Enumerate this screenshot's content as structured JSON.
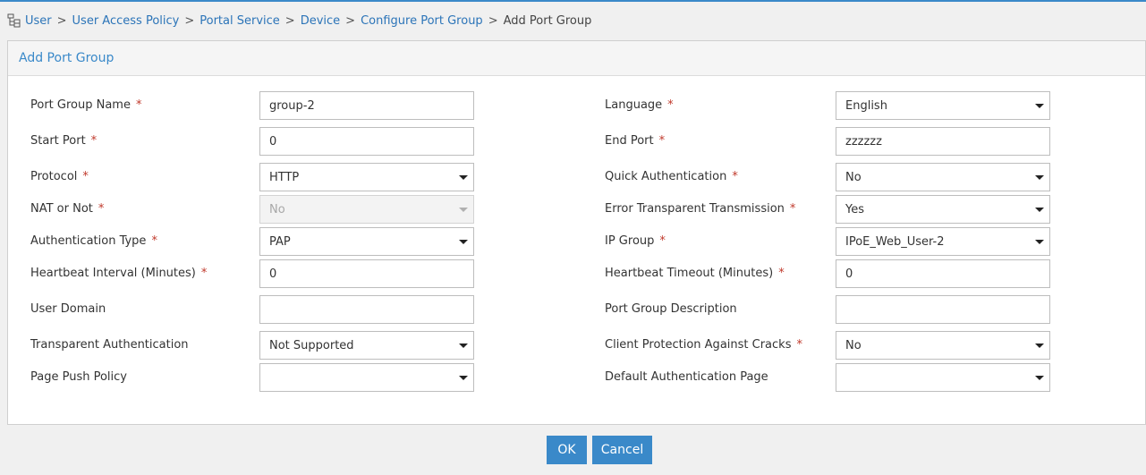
{
  "breadcrumb": {
    "icon": "tree-icon",
    "items": [
      "User",
      "User Access Policy",
      "Portal Service",
      "Device",
      "Configure Port Group"
    ],
    "current": "Add Port Group",
    "separator": ">"
  },
  "panel": {
    "title": "Add Port Group"
  },
  "required_mark": "*",
  "form": {
    "left": [
      {
        "label": "Port Group Name",
        "required": true,
        "type": "text",
        "value": "group-2"
      },
      {
        "label": "Start Port",
        "required": true,
        "type": "text",
        "value": "0"
      },
      {
        "label": "Protocol",
        "required": true,
        "type": "select",
        "value": "HTTP"
      },
      {
        "label": "NAT or Not",
        "required": true,
        "type": "select",
        "value": "No",
        "disabled": true
      },
      {
        "label": "Authentication Type",
        "required": true,
        "type": "select",
        "value": "PAP"
      },
      {
        "label": "Heartbeat Interval (Minutes)",
        "required": true,
        "type": "text",
        "value": "0"
      },
      {
        "label": "User Domain",
        "required": false,
        "type": "text",
        "value": ""
      },
      {
        "label": "Transparent Authentication",
        "required": false,
        "type": "select",
        "value": "Not Supported"
      },
      {
        "label": "Page Push Policy",
        "required": false,
        "type": "select",
        "value": ""
      }
    ],
    "right": [
      {
        "label": "Language",
        "required": true,
        "type": "select",
        "value": "English"
      },
      {
        "label": "End Port",
        "required": true,
        "type": "text",
        "value": "zzzzzz"
      },
      {
        "label": "Quick Authentication",
        "required": true,
        "type": "select",
        "value": "No"
      },
      {
        "label": "Error Transparent Transmission",
        "required": true,
        "type": "select",
        "value": "Yes"
      },
      {
        "label": "IP Group",
        "required": true,
        "type": "select",
        "value": "IPoE_Web_User-2"
      },
      {
        "label": "Heartbeat Timeout (Minutes)",
        "required": true,
        "type": "text",
        "value": "0"
      },
      {
        "label": "Port Group Description",
        "required": false,
        "type": "text",
        "value": ""
      },
      {
        "label": "Client Protection Against Cracks",
        "required": true,
        "type": "select",
        "value": "No"
      },
      {
        "label": "Default Authentication Page",
        "required": false,
        "type": "select",
        "value": ""
      }
    ]
  },
  "buttons": {
    "ok": "OK",
    "cancel": "Cancel"
  },
  "colors": {
    "accent": "#3a89c9",
    "link": "#2b74b8",
    "required": "#c0392b"
  }
}
